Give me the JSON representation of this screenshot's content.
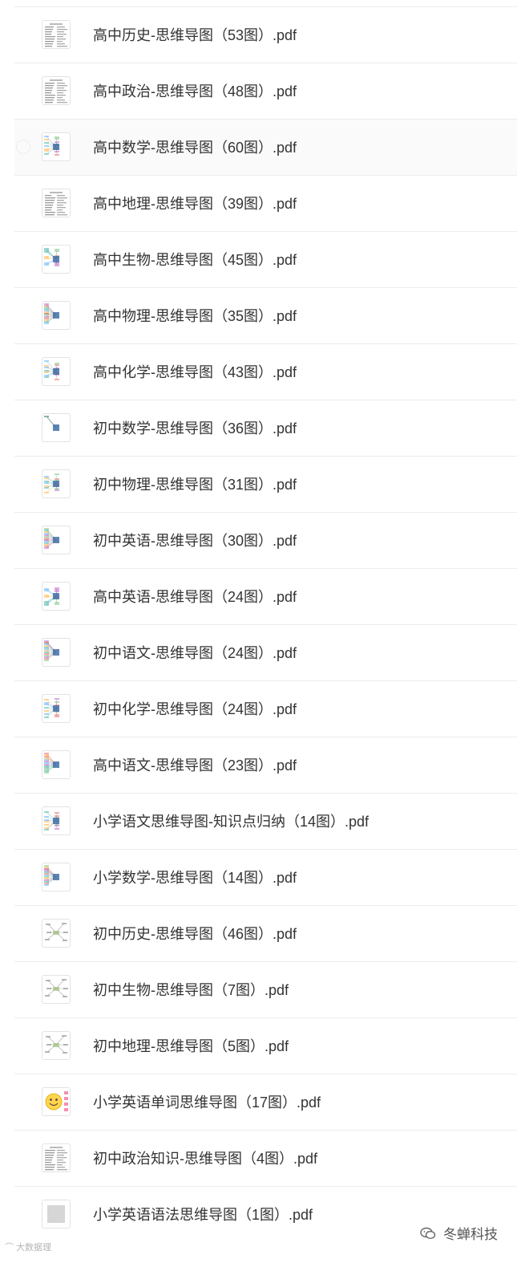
{
  "files": [
    {
      "name": "高中历史-思维导图（53图）.pdf",
      "thumb": "text-icon"
    },
    {
      "name": "高中政治-思维导图（48图）.pdf",
      "thumb": "text-icon"
    },
    {
      "name": "高中数学-思维导图（60图）.pdf",
      "thumb": "mindmap-icon"
    },
    {
      "name": "高中地理-思维导图（39图）.pdf",
      "thumb": "text-icon"
    },
    {
      "name": "高中生物-思维导图（45图）.pdf",
      "thumb": "mindmap-icon"
    },
    {
      "name": "高中物理-思维导图（35图）.pdf",
      "thumb": "mindmap-icon"
    },
    {
      "name": "高中化学-思维导图（43图）.pdf",
      "thumb": "mindmap-icon"
    },
    {
      "name": "初中数学-思维导图（36图）.pdf",
      "thumb": "mindmap-icon"
    },
    {
      "name": "初中物理-思维导图（31图）.pdf",
      "thumb": "mindmap-icon"
    },
    {
      "name": "初中英语-思维导图（30图）.pdf",
      "thumb": "mindmap-icon"
    },
    {
      "name": "高中英语-思维导图（24图）.pdf",
      "thumb": "mindmap-icon"
    },
    {
      "name": "初中语文-思维导图（24图）.pdf",
      "thumb": "mindmap-icon"
    },
    {
      "name": "初中化学-思维导图（24图）.pdf",
      "thumb": "mindmap-icon"
    },
    {
      "name": "高中语文-思维导图（23图）.pdf",
      "thumb": "mindmap-icon"
    },
    {
      "name": "小学语文思维导图-知识点归纳（14图）.pdf",
      "thumb": "mindmap-icon"
    },
    {
      "name": "小学数学-思维导图（14图）.pdf",
      "thumb": "mindmap-icon"
    },
    {
      "name": "初中历史-思维导图（46图）.pdf",
      "thumb": "sparse-mindmap-icon"
    },
    {
      "name": "初中生物-思维导图（7图）.pdf",
      "thumb": "sparse-mindmap-icon"
    },
    {
      "name": "初中地理-思维导图（5图）.pdf",
      "thumb": "sparse-mindmap-icon"
    },
    {
      "name": "小学英语单词思维导图（17图）.pdf",
      "thumb": "smiley-icon"
    },
    {
      "name": "初中政治知识-思维导图（4图）.pdf",
      "thumb": "text-icon"
    },
    {
      "name": "小学英语语法思维导图（1图）.pdf",
      "thumb": "gray-page-icon"
    }
  ],
  "footer": {
    "watermark_left": "大数据理",
    "account_name": "冬蝉科技"
  },
  "colors": {
    "text": "#333333",
    "divider": "#ececec",
    "thumb_border": "#e3e3e3"
  }
}
